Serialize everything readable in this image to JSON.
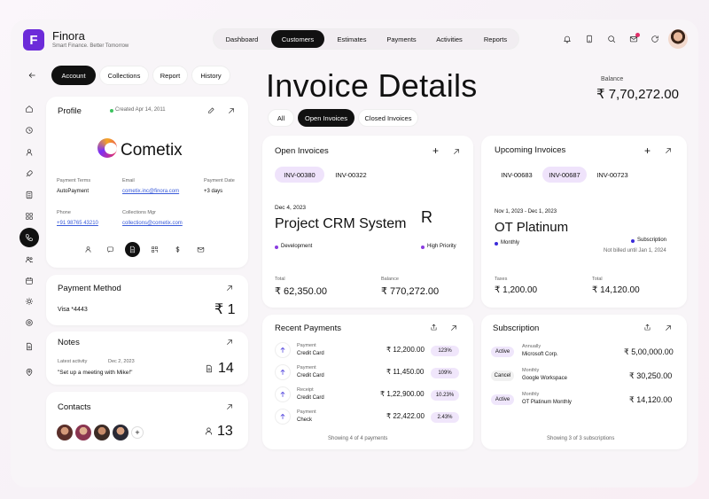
{
  "brand": {
    "name": "Finora",
    "tagline": "Smart Finance. Better Tomorrow",
    "logo_letter": "F",
    "accent": "#6c2bd9"
  },
  "nav": {
    "items": [
      "Dashboard",
      "Customers",
      "Estimates",
      "Payments",
      "Activities",
      "Reports"
    ],
    "active": "Customers"
  },
  "subtabs": {
    "items": [
      "Account",
      "Collections",
      "Report",
      "History"
    ],
    "active": "Account"
  },
  "page": {
    "title": "Invoice Details",
    "balance_label": "Balance",
    "balance_value": "₹ 7,70,272.00"
  },
  "filters": {
    "items": [
      "All",
      "Open Invoices",
      "Closed Invoices"
    ],
    "active": "Open Invoices"
  },
  "profile": {
    "title": "Profile",
    "created": "Created Apr 14, 2011",
    "company": "Cometix",
    "payment_terms_label": "Payment Terms",
    "payment_terms": "AutoPayment",
    "email_label": "Email",
    "email": "cometix.inc@finora.com",
    "payment_date_label": "Payment Date",
    "payment_date": "+3 days",
    "phone_label": "Phone",
    "phone": "+91 98765 43210",
    "collections_label": "Collections Mgr",
    "collections": "collections@cometix.com"
  },
  "payment_method": {
    "title": "Payment Method",
    "card": "Visa *4443",
    "count": "₹ 1"
  },
  "notes": {
    "title": "Notes",
    "latest_label": "Latest activity",
    "date": "Dec 2, 2023",
    "text": "\"Set up a meeting with Mike!\"",
    "count": "14"
  },
  "contacts": {
    "title": "Contacts",
    "count": "13",
    "add": "+"
  },
  "open_invoices": {
    "title": "Open Invoices",
    "tabs": [
      "INV-00380",
      "INV-00322"
    ],
    "active_tab": "INV-00380",
    "date": "Dec 4, 2023",
    "name": "Project CRM System",
    "avatar_letter": "R",
    "status": "Development",
    "priority": "High Priority",
    "total_label": "Total",
    "total": "₹ 62,350.00",
    "balance_label": "Balance",
    "balance": "₹ 770,272.00"
  },
  "upcoming_invoices": {
    "title": "Upcoming Invoices",
    "tabs": [
      "INV-00683",
      "INV-00687",
      "INV-00723"
    ],
    "active_tab": "INV-00687",
    "date": "Nov 1, 2023 - Dec 1, 2023",
    "name": "OT Platinum",
    "frequency": "Monthly",
    "type": "Subscription",
    "not_billed": "Not billed until Jan 1, 2024",
    "taxes_label": "Taxes",
    "taxes": "₹ 1,200.00",
    "total_label": "Total",
    "total": "₹ 14,120.00"
  },
  "recent_payments": {
    "title": "Recent Payments",
    "rows": [
      {
        "kind": "Payment",
        "method": "Credit Card",
        "amount": "₹ 12,200.00",
        "pct": "123%"
      },
      {
        "kind": "Payment",
        "method": "Credit Card",
        "amount": "₹ 11,450.00",
        "pct": "109%"
      },
      {
        "kind": "Receipt",
        "method": "Credit Card",
        "amount": "₹ 1,22,900.00",
        "pct": "10.23%"
      },
      {
        "kind": "Payment",
        "method": "Check",
        "amount": "₹ 22,422.00",
        "pct": "2.43%"
      }
    ],
    "footer": "Showing 4 of 4 payments"
  },
  "subscription": {
    "title": "Subscription",
    "rows": [
      {
        "status": "Active",
        "freq": "Annually",
        "name": "Microsoft Corp.",
        "amount": "₹ 5,00,000.00"
      },
      {
        "status": "Cancel",
        "freq": "Monthly",
        "name": "Google Workspace",
        "amount": "₹ 30,250.00"
      },
      {
        "status": "Active",
        "freq": "Monthly",
        "name": "OT Platinum Monthly",
        "amount": "₹ 14,120.00"
      }
    ],
    "footer": "Showing 3 of 3 subscriptions"
  }
}
